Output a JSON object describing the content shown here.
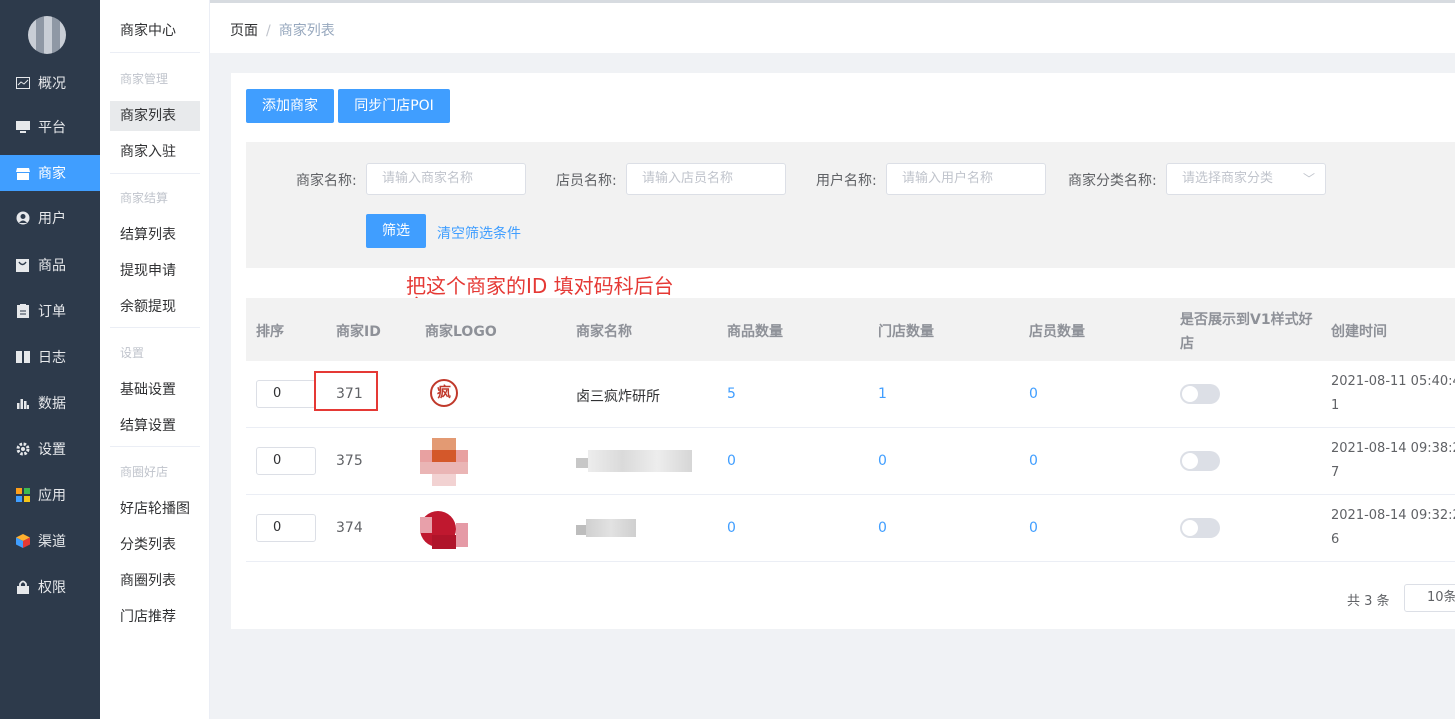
{
  "sidebar": {
    "items": [
      {
        "label": "概况",
        "icon": "chart-icon"
      },
      {
        "label": "平台",
        "icon": "monitor-icon"
      },
      {
        "label": "商家",
        "icon": "store-icon",
        "active": true
      },
      {
        "label": "用户",
        "icon": "user-icon"
      },
      {
        "label": "商品",
        "icon": "goods-icon"
      },
      {
        "label": "订单",
        "icon": "order-icon"
      },
      {
        "label": "日志",
        "icon": "book-icon"
      },
      {
        "label": "数据",
        "icon": "bar-icon"
      },
      {
        "label": "设置",
        "icon": "gear-icon"
      },
      {
        "label": "应用",
        "icon": "apps-icon"
      },
      {
        "label": "渠道",
        "icon": "cube-icon"
      },
      {
        "label": "权限",
        "icon": "lock-icon"
      }
    ]
  },
  "submenu": {
    "title": "商家中心",
    "groups": {
      "merchant_mgmt": "商家管理",
      "settlement": "商家结算",
      "settings": "设置",
      "circle": "商圈好店"
    },
    "items": {
      "merchant_list": "商家列表",
      "merchant_join": "商家入驻",
      "settle_list": "结算列表",
      "withdraw_apply": "提现申请",
      "balance_withdraw": "余额提现",
      "basic_settings": "基础设置",
      "settle_settings": "结算设置",
      "banner": "好店轮播图",
      "category_list": "分类列表",
      "circle_list": "商圈列表",
      "store_recommend": "门店推荐"
    }
  },
  "breadcrumb": {
    "root": "页面",
    "separator": "/",
    "current": "商家列表"
  },
  "toolbar": {
    "add": "添加商家",
    "sync": "同步门店POI"
  },
  "filters": {
    "merchant_name": {
      "label": "商家名称:",
      "placeholder": "请输入商家名称"
    },
    "clerk_name": {
      "label": "店员名称:",
      "placeholder": "请输入店员名称"
    },
    "user_name": {
      "label": "用户名称:",
      "placeholder": "请输入用户名称"
    },
    "category": {
      "label": "商家分类名称:",
      "placeholder": "请选择商家分类"
    },
    "submit": "筛选",
    "clear": "清空筛选条件"
  },
  "annotation": "把这个商家的ID 填对码科后台",
  "table": {
    "headers": {
      "sort": "排序",
      "id": "商家ID",
      "logo": "商家LOGO",
      "name": "商家名称",
      "goods": "商品数量",
      "stores": "门店数量",
      "clerks": "店员数量",
      "v1_line1": "是否展示到V1样式好",
      "v1_line2": "店",
      "created": "创建时间"
    },
    "rows": [
      {
        "sort": "0",
        "id": "371",
        "name": "卤三疯炸研所",
        "goods": "5",
        "stores": "1",
        "clerks": "0",
        "created_1": "2021-08-11 05:40:4",
        "created_2": "1",
        "logo_char": "疯"
      },
      {
        "sort": "0",
        "id": "375",
        "name": "",
        "goods": "0",
        "stores": "0",
        "clerks": "0",
        "created_1": "2021-08-14 09:38:2",
        "created_2": "7"
      },
      {
        "sort": "0",
        "id": "374",
        "name": "",
        "goods": "0",
        "stores": "0",
        "clerks": "0",
        "created_1": "2021-08-14 09:32:2",
        "created_2": "6"
      }
    ]
  },
  "pagination": {
    "total": "共 3 条",
    "size": "10条"
  },
  "colors": {
    "primary": "#409eff",
    "sidebar": "#2d3a4b",
    "annotation": "#e53935"
  }
}
